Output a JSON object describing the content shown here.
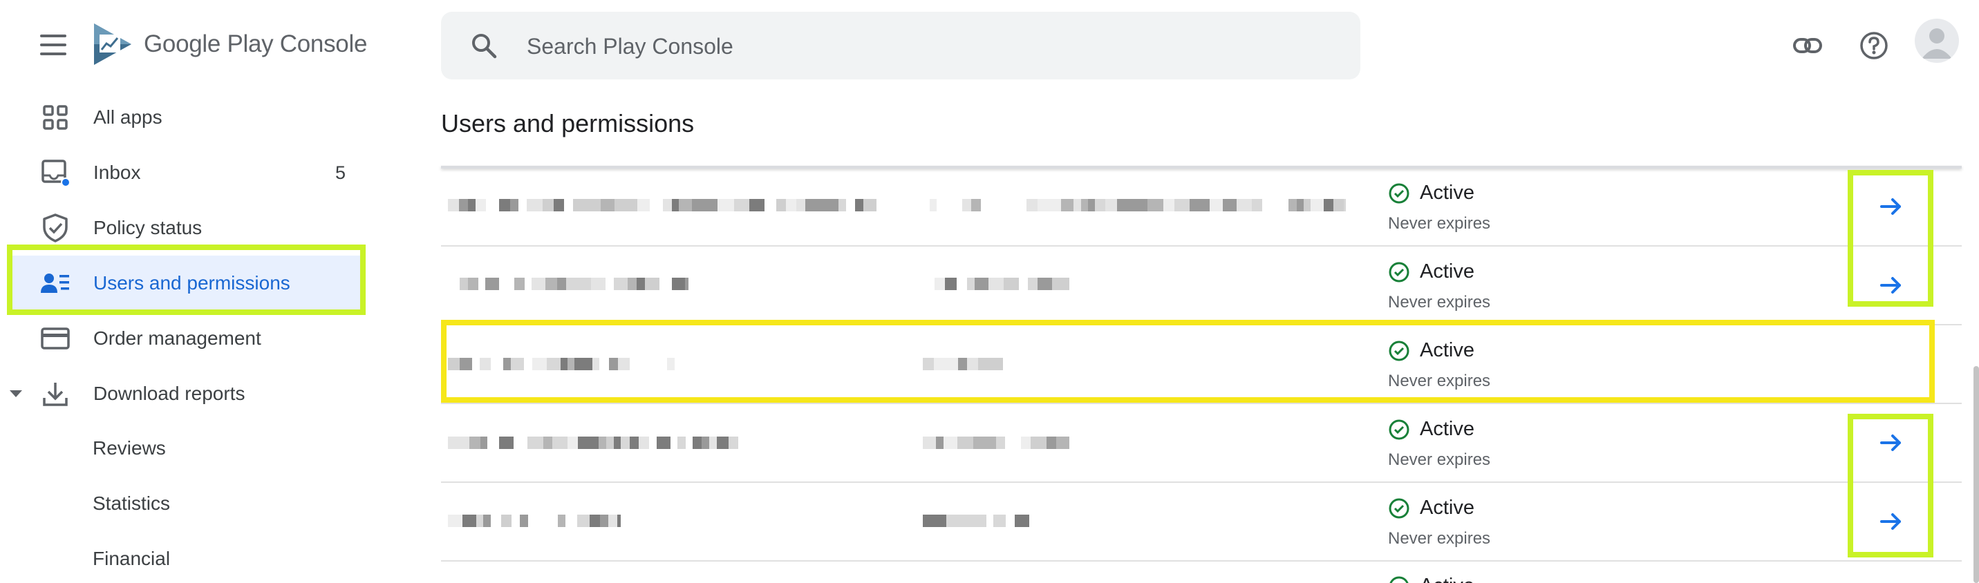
{
  "header": {
    "brand": "Google Play Console",
    "search_placeholder": "Search Play Console",
    "icons": [
      "menu-icon",
      "play-console-logo",
      "search-icon",
      "link-icon",
      "help-icon",
      "account-avatar-icon"
    ]
  },
  "sidebar": {
    "items": [
      {
        "label": "All apps",
        "icon": "grid-icon"
      },
      {
        "label": "Inbox",
        "icon": "inbox-icon",
        "count": "5"
      },
      {
        "label": "Policy status",
        "icon": "shield-icon"
      },
      {
        "label": "Users and permissions",
        "icon": "users-icon",
        "active": true
      },
      {
        "label": "Order management",
        "icon": "credit-card-icon"
      },
      {
        "label": "Download reports",
        "icon": "download-icon",
        "expanded": true
      }
    ],
    "sub_items": [
      {
        "label": "Reviews"
      },
      {
        "label": "Statistics"
      },
      {
        "label": "Financial"
      }
    ]
  },
  "main": {
    "title": "Users and permissions",
    "rows": [
      {
        "status": "Active",
        "expiry": "Never expires",
        "has_arrow": true
      },
      {
        "status": "Active",
        "expiry": "Never expires",
        "has_arrow": true
      },
      {
        "status": "Active",
        "expiry": "Never expires",
        "has_arrow": false
      },
      {
        "status": "Active",
        "expiry": "Never expires",
        "has_arrow": true
      },
      {
        "status": "Active",
        "expiry": "Never expires",
        "has_arrow": true
      },
      {
        "status": "Active",
        "expiry": "",
        "has_arrow": false
      }
    ]
  },
  "colors": {
    "accent_blue": "#1a73e8",
    "active_nav_bg": "#e8f0fe",
    "active_nav_text": "#1967d2",
    "status_green": "#188038",
    "highlight_green": "#c9f227",
    "highlight_yellow": "#f6e71a"
  }
}
